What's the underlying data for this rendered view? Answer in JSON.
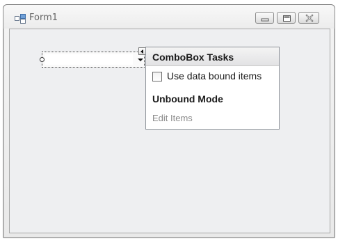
{
  "window": {
    "title": "Form1"
  },
  "combobox": {
    "value": ""
  },
  "tasks_panel": {
    "title": "ComboBox Tasks",
    "use_data_bound_label": "Use data bound items",
    "use_data_bound_checked": false,
    "mode_header": "Unbound Mode",
    "edit_items_label": "Edit Items"
  },
  "icons": {
    "app": "form-designer-icon",
    "minimize": "minimize-icon",
    "maximize": "maximize-icon",
    "close": "close-icon",
    "smart_tag": "smart-tag-icon"
  }
}
